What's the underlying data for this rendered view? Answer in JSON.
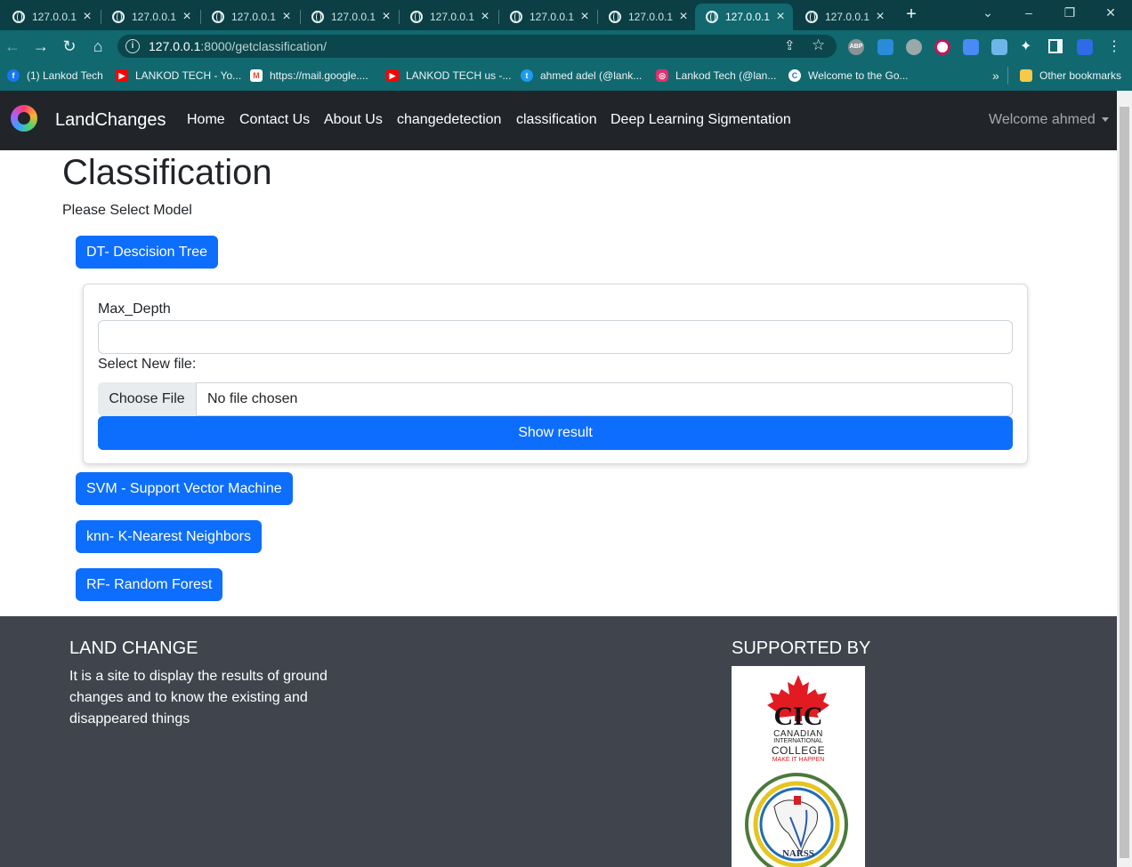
{
  "browser": {
    "tabs": [
      {
        "label": "127.0.0.1"
      },
      {
        "label": "127.0.0.1"
      },
      {
        "label": "127.0.0.1"
      },
      {
        "label": "127.0.0.1"
      },
      {
        "label": "127.0.0.1"
      },
      {
        "label": "127.0.0.1"
      },
      {
        "label": "127.0.0.1"
      },
      {
        "label": "127.0.0.1"
      },
      {
        "label": "127.0.0.1"
      }
    ],
    "active_tab_index": 7,
    "url_host": "127.0.0.1",
    "url_path": ":8000/getclassification/",
    "bookmarks": [
      {
        "label": "(1) Lankod Tech",
        "icon": "facebook-icon",
        "color": "#1877f2"
      },
      {
        "label": "LANKOD TECH - Yo...",
        "icon": "youtube-icon",
        "color": "#ff0000"
      },
      {
        "label": "https://mail.google....",
        "icon": "gmail-icon",
        "color": "#ea4335"
      },
      {
        "label": "LANKOD TECH us -...",
        "icon": "youtube-icon",
        "color": "#ff0000"
      },
      {
        "label": "ahmed adel (@lank...",
        "icon": "twitter-icon",
        "color": "#1d9bf0"
      },
      {
        "label": "Lankod Tech (@lan...",
        "icon": "instagram-icon",
        "color": "#e1306c"
      },
      {
        "label": "Welcome to the Go...",
        "icon": "coursera-icon",
        "color": "#2a73cc"
      }
    ],
    "other_bookmarks": "Other bookmarks",
    "more_bookmarks": "»"
  },
  "navbar": {
    "brand": "LandChanges",
    "links": [
      "Home",
      "Contact Us",
      "About Us",
      "changedetection",
      "classification",
      "Deep Learning Sigmentation"
    ],
    "welcome": "Welcome ahmed"
  },
  "main": {
    "title": "Classification",
    "subtitle": "Please Select Model",
    "models": {
      "dt": "DT- Descision Tree",
      "svm": "SVM - Support Vector Machine",
      "knn": "knn- K-Nearest Neighbors",
      "rf": "RF- Random Forest"
    },
    "form": {
      "max_depth_label": "Max_Depth",
      "max_depth_value": "",
      "file_label": "Select New file:",
      "choose_file": "Choose File",
      "no_file": "No file chosen",
      "submit": "Show result"
    }
  },
  "footer": {
    "title": "LAND CHANGE",
    "text": "It is a site to display the results of ground changes and to know the existing and disappeared things",
    "supported_title": "SUPPORTED BY",
    "cic": {
      "initials": "CIC",
      "line1": "CANADIAN",
      "line2": "INTERNATIONAL",
      "line3": "COLLEGE",
      "tagline": "MAKE IT HAPPEN"
    },
    "narss": "NARSS"
  },
  "colors": {
    "primary": "#0d6efd",
    "navbar_bg": "#212529",
    "footer_bg": "#3f444d",
    "chrome_dark": "#0b3f45",
    "chrome": "#11686f"
  }
}
